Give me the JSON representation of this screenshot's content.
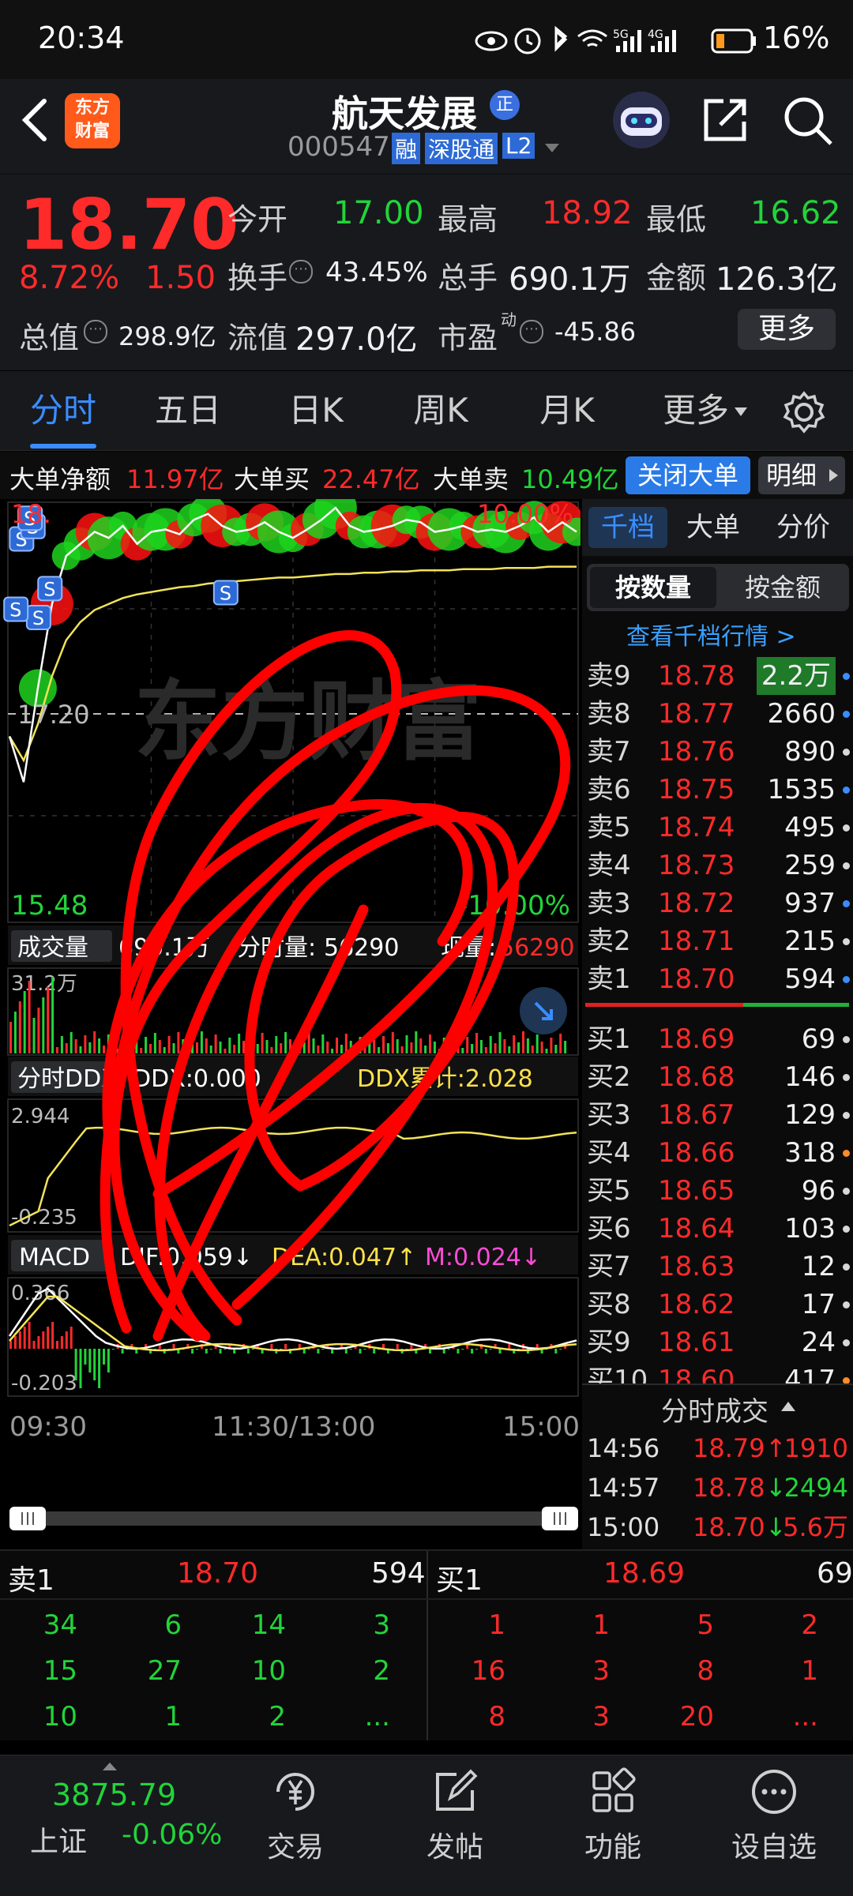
{
  "status": {
    "time": "20:34",
    "battery": "16%",
    "net1": "5G",
    "net2": "4G"
  },
  "header": {
    "stock_name": "航天发展",
    "badge": "正",
    "code": "000547",
    "tag_rong": "融",
    "tag_sgt": "深股通",
    "tag_l2": "L2",
    "logo_top": "东方",
    "logo_bottom": "财富"
  },
  "quote": {
    "price": "18.70",
    "pct": "8.72%",
    "change": "1.50",
    "open_label": "今开",
    "open": "17.00",
    "high_label": "最高",
    "high": "18.92",
    "low_label": "最低",
    "low": "16.62",
    "turnover_label": "换手",
    "turnover": "43.45%",
    "volume_label": "总手",
    "volume": "690.1万",
    "amount_label": "金额",
    "amount": "126.3亿",
    "mcap_label": "总值",
    "mcap": "298.9亿",
    "float_label": "流值",
    "float": "297.0亿",
    "pe_label": "市盈",
    "pe_sup": "动",
    "pe": "-45.86",
    "more": "更多"
  },
  "tabs": [
    "分时",
    "五日",
    "日K",
    "周K",
    "月K",
    "更多"
  ],
  "big_order": {
    "net_label": "大单净额",
    "net": "11.97亿",
    "buy_label": "大单买",
    "buy": "22.47亿",
    "sell_label": "大单卖",
    "sell": "10.49亿",
    "close_btn": "关闭大单",
    "detail_btn": "明细"
  },
  "chart": {
    "price_top": "18.",
    "price_mid": "17.20",
    "price_bottom": "15.48",
    "pct_top": "10.00%",
    "pct_bottom": "-10.00%",
    "watermark": "东方财富",
    "vol_label": "成交量",
    "vol_total": "690.1万",
    "vol_period_label": "分时量:",
    "vol_period": "56290",
    "vol_now_label": "现量:",
    "vol_now": "56290",
    "vol_axis": "31.2万",
    "ddx_label": "分时DDX",
    "ddx": "DDX:0.000",
    "ddx_cum": "DDX累计:2.028",
    "ddx_top": "2.944",
    "ddx_bottom": "-0.235",
    "macd_label": "MACD",
    "dif": "DIF:0.059↓",
    "dea": "DEA:0.047↑",
    "m": "M:0.024↓",
    "macd_top": "0.366",
    "macd_bottom": "-0.203",
    "time_start": "09:30",
    "time_mid": "11:30/13:00",
    "time_end": "15:00",
    "s_marker": "S"
  },
  "chart_data": {
    "type": "line",
    "title": "",
    "x_ticks": [
      "09:30",
      "11:30/13:00",
      "15:00"
    ],
    "ylim": [
      15.48,
      18.92
    ],
    "reference_price": 17.2,
    "series": [
      {
        "values": [
          17.0,
          16.62,
          17.4,
          18.1,
          18.5,
          18.6,
          18.7,
          18.65,
          18.75,
          18.6,
          18.7,
          18.72,
          18.68,
          18.8,
          18.85,
          18.75,
          18.7,
          18.72,
          18.78,
          18.7,
          18.65,
          18.72,
          18.8,
          18.9,
          18.75,
          18.7,
          18.72,
          18.75,
          18.8,
          18.78,
          18.7,
          18.72,
          18.75,
          18.7,
          18.72,
          18.7,
          18.75,
          18.82,
          18.7,
          18.78,
          18.7
        ]
      },
      {
        "values": [
          17.0,
          16.8,
          17.1,
          17.5,
          17.8,
          17.95,
          18.05,
          18.1,
          18.15,
          18.18,
          18.2,
          18.22,
          18.24,
          18.25,
          18.27,
          18.28,
          18.29,
          18.3,
          18.31,
          18.32,
          18.32,
          18.33,
          18.34,
          18.35,
          18.35,
          18.36,
          18.36,
          18.37,
          18.37,
          18.38,
          18.38,
          18.38,
          18.39,
          18.39,
          18.39,
          18.4,
          18.4,
          18.4,
          18.41,
          18.41,
          18.41
        ]
      }
    ]
  },
  "orderbook": {
    "tabs": [
      "千档",
      "大单",
      "分价"
    ],
    "sub_tabs": [
      "按数量",
      "按金额"
    ],
    "link": "查看千档行情 >",
    "asks": [
      {
        "label": "卖9",
        "price": "18.78",
        "vol": "2.2万",
        "dot": "#3a8dff"
      },
      {
        "label": "卖8",
        "price": "18.77",
        "vol": "2660",
        "dot": "#3a8dff"
      },
      {
        "label": "卖7",
        "price": "18.76",
        "vol": "890",
        "dot": "#d8d8d8"
      },
      {
        "label": "卖6",
        "price": "18.75",
        "vol": "1535",
        "dot": "#3a8dff"
      },
      {
        "label": "卖5",
        "price": "18.74",
        "vol": "495",
        "dot": "#d8d8d8"
      },
      {
        "label": "卖4",
        "price": "18.73",
        "vol": "259",
        "dot": "#d8d8d8"
      },
      {
        "label": "卖3",
        "price": "18.72",
        "vol": "937",
        "dot": "#3a8dff"
      },
      {
        "label": "卖2",
        "price": "18.71",
        "vol": "215",
        "dot": "#d8d8d8"
      },
      {
        "label": "卖1",
        "price": "18.70",
        "vol": "594",
        "dot": "#3a8dff"
      }
    ],
    "bids": [
      {
        "label": "买1",
        "price": "18.69",
        "vol": "69",
        "dot": "#d8d8d8"
      },
      {
        "label": "买2",
        "price": "18.68",
        "vol": "146",
        "dot": "#d8d8d8"
      },
      {
        "label": "买3",
        "price": "18.67",
        "vol": "129",
        "dot": "#d8d8d8"
      },
      {
        "label": "买4",
        "price": "18.66",
        "vol": "318",
        "dot": "#ff8a2a"
      },
      {
        "label": "买5",
        "price": "18.65",
        "vol": "96",
        "dot": "#d8d8d8"
      },
      {
        "label": "买6",
        "price": "18.64",
        "vol": "103",
        "dot": "#d8d8d8"
      },
      {
        "label": "买7",
        "price": "18.63",
        "vol": "12",
        "dot": "#d8d8d8"
      },
      {
        "label": "买8",
        "price": "18.62",
        "vol": "17",
        "dot": "#d8d8d8"
      },
      {
        "label": "买9",
        "price": "18.61",
        "vol": "24",
        "dot": "#d8d8d8"
      },
      {
        "label": "买10",
        "price": "18.60",
        "vol": "417",
        "dot": "#ff8a2a"
      }
    ],
    "ticks_title": "分时成交",
    "ticks": [
      {
        "time": "14:56",
        "price": "18.79",
        "dir": "↑",
        "vol": "1910",
        "color": "#ff2a2a"
      },
      {
        "time": "14:57",
        "price": "18.78",
        "dir": "↓",
        "vol": "2494",
        "color": "#22d43a"
      },
      {
        "time": "15:00",
        "price": "18.70",
        "dir": "↓",
        "vol": "5.6万",
        "color": "#ff2a2a"
      }
    ]
  },
  "bottom_book": {
    "sell_label": "卖1",
    "sell_price": "18.70",
    "sell_vol": "594",
    "buy_label": "买1",
    "buy_price": "18.69",
    "buy_vol": "69",
    "sell_queue": [
      [
        "34",
        "6",
        "14",
        "3"
      ],
      [
        "15",
        "27",
        "10",
        "2"
      ],
      [
        "10",
        "1",
        "2",
        "..."
      ]
    ],
    "buy_queue": [
      [
        "1",
        "1",
        "5",
        "2"
      ],
      [
        "16",
        "3",
        "8",
        "1"
      ],
      [
        "8",
        "3",
        "20",
        "..."
      ]
    ]
  },
  "navbar": {
    "index_value": "3875.79",
    "index_name": "上证",
    "index_change": "-0.06%",
    "items": [
      "交易",
      "发帖",
      "功能",
      "设自选"
    ]
  }
}
